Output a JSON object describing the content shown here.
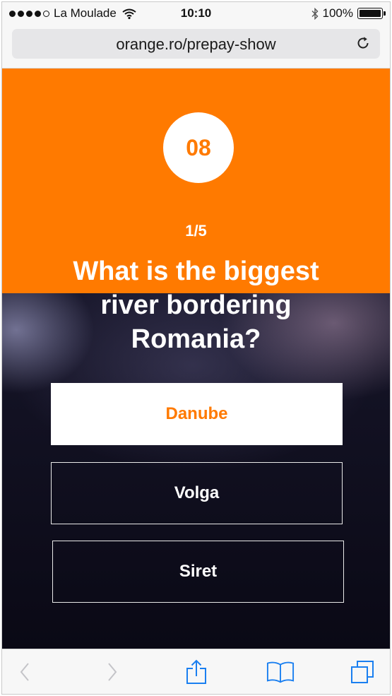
{
  "status_bar": {
    "carrier": "La Moulade",
    "time": "10:10",
    "battery": "100%",
    "signal_bars_filled": 4,
    "signal_bars_total": 5
  },
  "browser": {
    "url": "orange.ro/prepay-show"
  },
  "quiz": {
    "timer": "08",
    "progress": "1/5",
    "question": "What is the biggest river bordering Romania?",
    "answers": [
      {
        "label": "Danube",
        "selected": true
      },
      {
        "label": "Volga",
        "selected": false
      },
      {
        "label": "Siret",
        "selected": false
      }
    ]
  },
  "icons": {
    "status": [
      "wifi-icon",
      "bluetooth-icon",
      "battery-icon"
    ],
    "address_bar": [
      "reload-icon"
    ],
    "toolbar": [
      "back-icon",
      "forward-icon",
      "share-icon",
      "bookmarks-icon",
      "tabs-icon"
    ]
  },
  "colors": {
    "brand_orange": "#ff7a00",
    "ios_blue": "#1a7ff0",
    "disabled_gray": "#c4c4c8",
    "dark_background": "#0c0b18"
  }
}
